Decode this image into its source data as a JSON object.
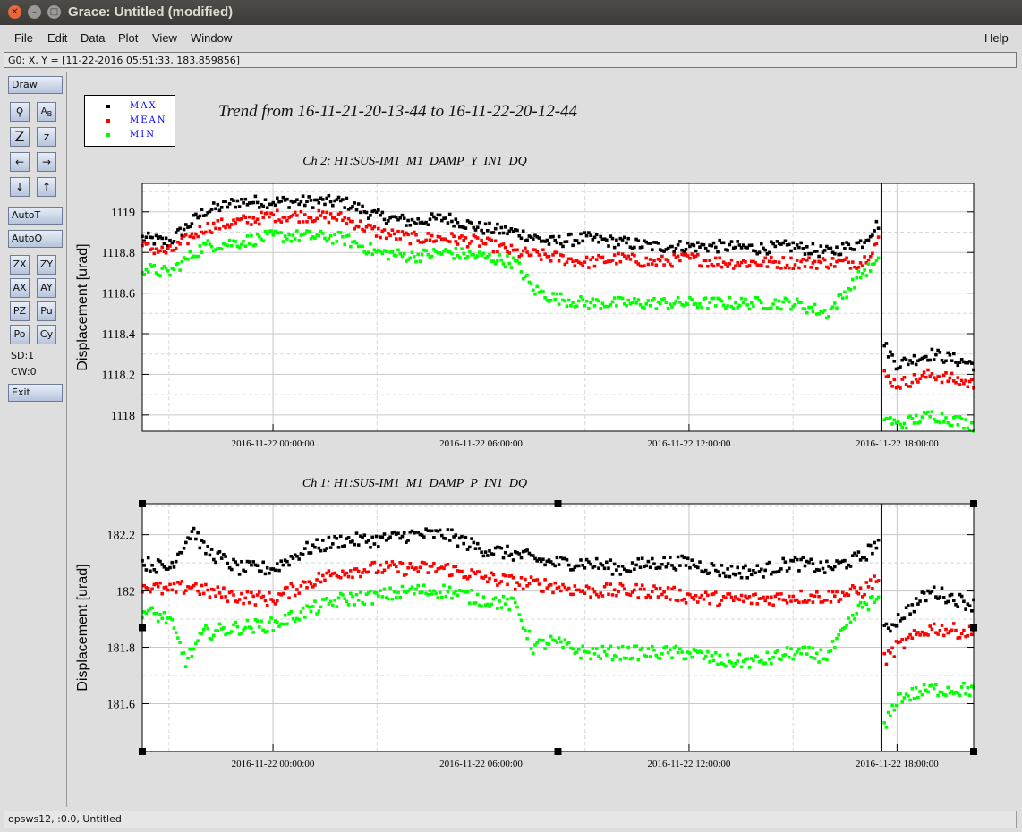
{
  "window": {
    "title": "Grace: Untitled (modified)"
  },
  "menu": {
    "file": "File",
    "edit": "Edit",
    "data": "Data",
    "plot": "Plot",
    "view": "View",
    "window": "Window",
    "help": "Help"
  },
  "coord_readout": "G0: X, Y = [11-22-2016 05:51:33, 183.859856]",
  "toolbar": {
    "draw": "Draw",
    "autot": "AutoT",
    "autoo": "AutoO",
    "zx": "ZX",
    "zy": "ZY",
    "ax": "AX",
    "ay": "AY",
    "pz": "PZ",
    "pu": "Pu",
    "po": "Po",
    "cy": "Cy",
    "sd": "SD:1",
    "cw": "CW:0",
    "exit": "Exit"
  },
  "status": "opsws12, :0.0, Untitled",
  "legend": [
    {
      "label": "MAX",
      "color": "#000000"
    },
    {
      "label": "MEAN",
      "color": "#ff0000"
    },
    {
      "label": "MIN",
      "color": "#00ff00"
    }
  ],
  "main_title": "Trend from 16-11-21-20-13-44 to 16-11-22-20-12-44",
  "colors": {
    "max": "#000000",
    "mean": "#ff0000",
    "min": "#00ff00"
  },
  "chart_data": [
    {
      "type": "scatter",
      "title": "Ch 2: H1:SUS-IM1_M1_DAMP_Y_IN1_DQ",
      "ylabel": "Displacement [urad]",
      "xlabel": "",
      "x_tick_labels": [
        "2016-11-22 00:00:00",
        "2016-11-22 06:00:00",
        "2016-11-22 12:00:00",
        "2016-11-22 18:00:00"
      ],
      "x_tick_hours": [
        0,
        6,
        12,
        18
      ],
      "xlim_hours": [
        -3.77,
        20.21
      ],
      "y_ticks": [
        1118,
        1118.2,
        1118.4,
        1118.6,
        1118.8,
        1119
      ],
      "y_tick_labels": [
        "1118",
        "1118.2",
        "1118.4",
        "1118.6",
        "1118.8",
        "1119"
      ],
      "ylim": [
        1117.92,
        1119.14
      ],
      "grid": true,
      "step_hour": 17.55,
      "series": [
        {
          "name": "MAX",
          "color": "#000000",
          "x": [
            -3.77,
            -3,
            -2,
            -1,
            0,
            1,
            2,
            3,
            4,
            5,
            6,
            7,
            8,
            9,
            10,
            11,
            12,
            13,
            14,
            15,
            16,
            17,
            17.5,
            17.6,
            18,
            19,
            20.21
          ],
          "y": [
            1118.87,
            1118.85,
            1119.0,
            1119.05,
            1119.05,
            1119.05,
            1119.05,
            1118.98,
            1118.95,
            1118.97,
            1118.92,
            1118.9,
            1118.85,
            1118.87,
            1118.85,
            1118.83,
            1118.83,
            1118.83,
            1118.82,
            1118.83,
            1118.8,
            1118.85,
            1118.95,
            1118.35,
            1118.25,
            1118.3,
            1118.25
          ]
        },
        {
          "name": "MEAN",
          "color": "#ff0000",
          "x": [
            -3.77,
            -3,
            -2,
            -1,
            0,
            1,
            2,
            3,
            4,
            5,
            6,
            7,
            8,
            9,
            10,
            11,
            12,
            13,
            14,
            15,
            16,
            17,
            17.5,
            17.6,
            18,
            19,
            20.21
          ],
          "y": [
            1118.83,
            1118.8,
            1118.92,
            1118.95,
            1118.98,
            1118.98,
            1118.97,
            1118.9,
            1118.87,
            1118.87,
            1118.85,
            1118.8,
            1118.78,
            1118.75,
            1118.77,
            1118.75,
            1118.77,
            1118.75,
            1118.75,
            1118.75,
            1118.75,
            1118.75,
            1118.87,
            1118.2,
            1118.15,
            1118.2,
            1118.15
          ]
        },
        {
          "name": "MIN",
          "color": "#00ff00",
          "x": [
            -3.77,
            -3,
            -2,
            -1,
            0,
            1,
            2,
            3,
            4,
            5,
            6,
            7,
            7.5,
            8,
            9,
            10,
            11,
            12,
            13,
            14,
            15,
            16,
            17,
            17.5,
            17.6,
            18,
            19,
            20.21
          ],
          "y": [
            1118.72,
            1118.7,
            1118.83,
            1118.85,
            1118.88,
            1118.88,
            1118.87,
            1118.8,
            1118.78,
            1118.8,
            1118.78,
            1118.75,
            1118.62,
            1118.58,
            1118.55,
            1118.55,
            1118.55,
            1118.55,
            1118.55,
            1118.55,
            1118.55,
            1118.5,
            1118.7,
            1118.75,
            1118.0,
            1117.95,
            1118.0,
            1117.95
          ]
        }
      ]
    },
    {
      "type": "scatter",
      "title": "Ch 1: H1:SUS-IM1_M1_DAMP_P_IN1_DQ",
      "ylabel": "Displacement [urad]",
      "xlabel": "",
      "x_tick_labels": [
        "2016-11-22 00:00:00",
        "2016-11-22 06:00:00",
        "2016-11-22 12:00:00",
        "2016-11-22 18:00:00"
      ],
      "x_tick_hours": [
        0,
        6,
        12,
        18
      ],
      "xlim_hours": [
        -3.77,
        20.21
      ],
      "y_ticks": [
        181.6,
        181.8,
        182,
        182.2
      ],
      "y_tick_labels": [
        "181.6",
        "181.8",
        "182",
        "182.2"
      ],
      "ylim": [
        181.43,
        182.31
      ],
      "grid": true,
      "step_hour": 17.55,
      "series": [
        {
          "name": "MAX",
          "color": "#000000",
          "x": [
            -3.77,
            -3,
            -2.3,
            -2,
            -1,
            0,
            1,
            2,
            3,
            4,
            5,
            6,
            7,
            8,
            9,
            10,
            11,
            12,
            13,
            14,
            15,
            16,
            17,
            17.5,
            17.6,
            18,
            19,
            20.21
          ],
          "y": [
            182.1,
            182.08,
            182.22,
            182.15,
            182.08,
            182.08,
            182.15,
            182.18,
            182.18,
            182.2,
            182.2,
            182.15,
            182.13,
            182.1,
            182.1,
            182.08,
            182.1,
            182.1,
            182.07,
            182.07,
            182.1,
            182.08,
            182.12,
            182.18,
            181.85,
            181.9,
            182.0,
            181.95
          ]
        },
        {
          "name": "MEAN",
          "color": "#ff0000",
          "x": [
            -3.77,
            -3,
            -2.3,
            -2,
            -1,
            0,
            1,
            2,
            3,
            4,
            5,
            6,
            7,
            8,
            9,
            10,
            11,
            12,
            13,
            14,
            15,
            16,
            17,
            17.5,
            17.6,
            18,
            19,
            20.21
          ],
          "y": [
            182.02,
            182.0,
            182.02,
            182.0,
            181.98,
            181.97,
            182.03,
            182.07,
            182.08,
            182.08,
            182.08,
            182.05,
            182.03,
            182.02,
            182.0,
            182.0,
            182.0,
            181.98,
            181.97,
            181.97,
            181.98,
            181.98,
            182.0,
            182.05,
            181.75,
            181.8,
            181.87,
            181.85
          ]
        },
        {
          "name": "MIN",
          "color": "#00ff00",
          "x": [
            -3.77,
            -3,
            -2.5,
            -2,
            -1,
            0,
            1,
            2,
            3,
            4,
            5,
            6,
            7,
            7.5,
            8,
            9,
            10,
            11,
            12,
            13,
            14,
            15,
            16,
            17,
            17.5,
            17.6,
            18,
            19,
            20.21
          ],
          "y": [
            181.93,
            181.9,
            181.75,
            181.85,
            181.87,
            181.88,
            181.93,
            181.97,
            181.98,
            182.0,
            182.0,
            181.97,
            181.95,
            181.8,
            181.82,
            181.78,
            181.78,
            181.78,
            181.78,
            181.75,
            181.75,
            181.78,
            181.77,
            181.95,
            181.97,
            181.5,
            181.62,
            181.65,
            181.65
          ]
        }
      ]
    }
  ]
}
